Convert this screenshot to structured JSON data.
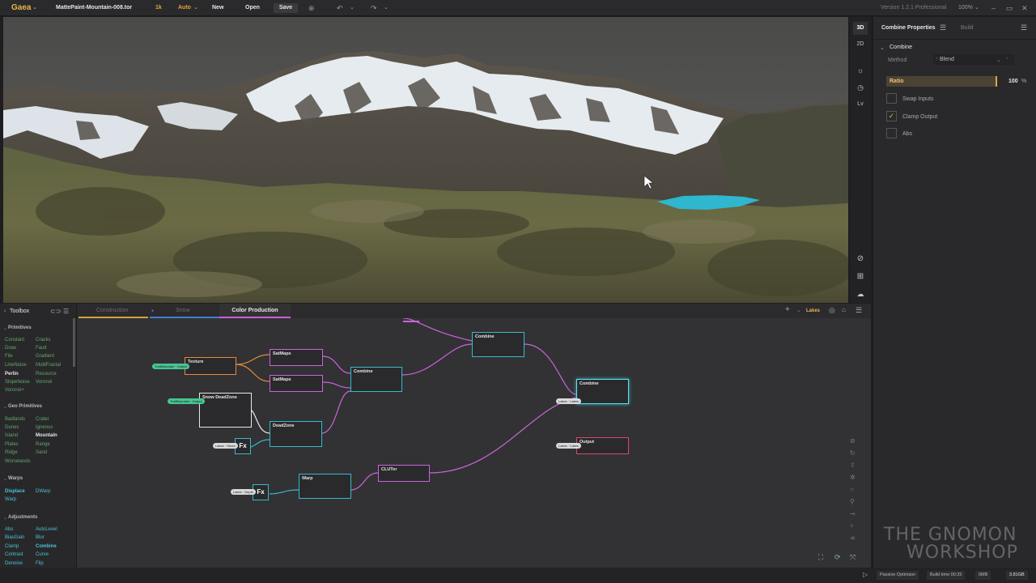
{
  "app": {
    "logo": "Gaea",
    "file_name": "MattePaint-Mountain-008.tor",
    "resolution": "1k",
    "auto": "Auto",
    "version": "Version 1.2.1 Professional",
    "zoom": "100%"
  },
  "toolbar": {
    "new_label": "New",
    "open_label": "Open",
    "save_label": "Save"
  },
  "viewport_tools": [
    "3D",
    "2D",
    "Lv"
  ],
  "properties": {
    "tab_title": "Combine Properties",
    "tab_build": "Build",
    "section": "Combine",
    "method_label": "Method",
    "method_value": "Blend",
    "ratio_label": "Ratio",
    "ratio_value": "100",
    "ratio_unit": "%",
    "options": [
      {
        "label": "Swap Inputs",
        "checked": false
      },
      {
        "label": "Clamp Output",
        "checked": true
      },
      {
        "label": "Abs",
        "checked": false
      }
    ]
  },
  "toolbox": {
    "title": "Toolbox",
    "sections": [
      {
        "name": "Primitives",
        "left": [
          "Constant",
          "Draw",
          "File",
          "LineNoise",
          "Perlin",
          "SlopeNoise",
          "Voronoi+"
        ],
        "right": [
          "Cracks",
          "Fault",
          "Gradient",
          "MultiFractal",
          "Resource",
          "Voronoi"
        ]
      },
      {
        "name": "Geo Primitives",
        "left": [
          "Badlands",
          "Dunes",
          "Island",
          "Plates",
          "Ridge",
          "Worselands"
        ],
        "right": [
          "Crater",
          "Igneous",
          "Mountain",
          "Range",
          "Sand"
        ]
      },
      {
        "name": "Warps",
        "left": [
          "Displace",
          "Warp"
        ],
        "right": [
          "DWarp"
        ]
      },
      {
        "name": "Adjustments",
        "left": [
          "Abs",
          "BiasGain",
          "Clamp",
          "Contrast",
          "Denoise"
        ],
        "right": [
          "AutoLevel",
          "Blur",
          "Combine",
          "Curve",
          "Flip"
        ]
      }
    ]
  },
  "graph_tabs": [
    "Construction",
    "Snow",
    "Color Production"
  ],
  "graph_right_label": "Lakes",
  "nodes": {
    "texture": "Texture",
    "satmaps1": "SatMaps",
    "satmaps2": "SatMaps",
    "combine1": "Combine",
    "combine2": "Combine",
    "combine3": "Combine",
    "snow_deadzone": "Snow DeadZone",
    "deadzone": "DeadZone",
    "warp": "Warp",
    "clut": "CLUTer",
    "output": "Output",
    "fx1": "Fx",
    "fx2": "Fx"
  },
  "pills": {
    "p1": "TrailMountain · Output",
    "p2": "TrailMountain · Output",
    "p3": "Lakes · Shore",
    "p4": "Lakes · Depth",
    "p5": "Lakes · Lakes",
    "p6": "Lakes · Lakes"
  },
  "status": {
    "passive": "Passive Optimizer",
    "build_time": "Build time 00:25",
    "mem": "0MB",
    "size": "3.81GB"
  },
  "watermark": {
    "line1": "THE GNOMON",
    "line2": "WORKSHOP"
  }
}
